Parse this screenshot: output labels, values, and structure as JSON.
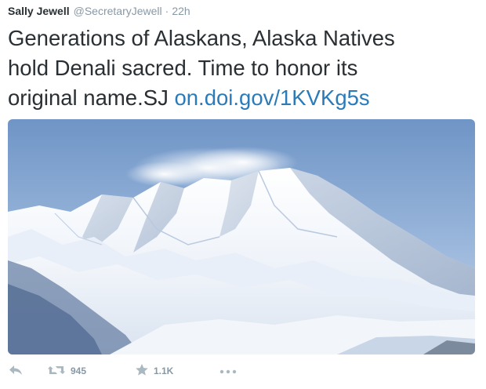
{
  "tweet": {
    "author_name": "Sally Jewell",
    "author_handle": "@SecretaryJewell",
    "separator": "·",
    "timestamp": "22h",
    "text_line1": "Generations of Alaskans, Alaska Natives",
    "text_line2": "hold Denali sacred. Time to honor its",
    "text_line3_prefix": "original name.SJ ",
    "link": "on.doi.gov/1KVKg5s"
  },
  "media": {
    "subject": "snow-covered mountain under blue sky"
  },
  "actions": {
    "reply_icon": "reply-icon",
    "retweet_icon": "retweet-icon",
    "retweet_count": "945",
    "favorite_icon": "star-icon",
    "favorite_count": "1.1K",
    "more_icon": "more-icon"
  },
  "colors": {
    "text": "#292f33",
    "muted": "#8899a6",
    "link": "#2b7bb9",
    "icon": "#aab8c2"
  }
}
